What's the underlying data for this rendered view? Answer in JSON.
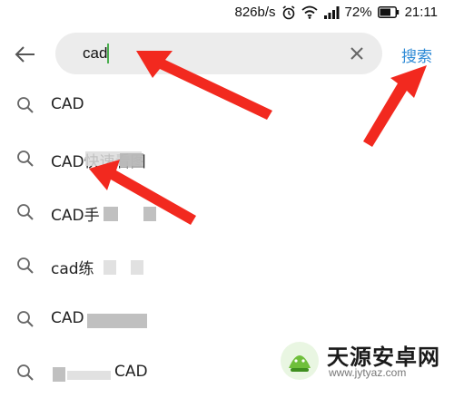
{
  "status_bar": {
    "network_speed": "826b/s",
    "battery_percent": "72%",
    "battery_level": 0.72,
    "time": "21:11",
    "icons": [
      "alarm-icon",
      "wifi-icon",
      "signal-icon",
      "battery-icon"
    ]
  },
  "search": {
    "query": "cad",
    "search_button_label": "搜索"
  },
  "suggestions": [
    {
      "text": "CAD"
    },
    {
      "text": "CAD快速看图"
    },
    {
      "text": "CAD手"
    },
    {
      "text": "cad练"
    },
    {
      "text": "CAD"
    },
    {
      "text": "CAD"
    }
  ],
  "watermark": {
    "name": "天源安卓网",
    "url": "www.jytyaz.com"
  },
  "colors": {
    "accent": "#2f8bd6",
    "annotation_arrow": "#f2291f",
    "cursor": "#4caf50"
  }
}
